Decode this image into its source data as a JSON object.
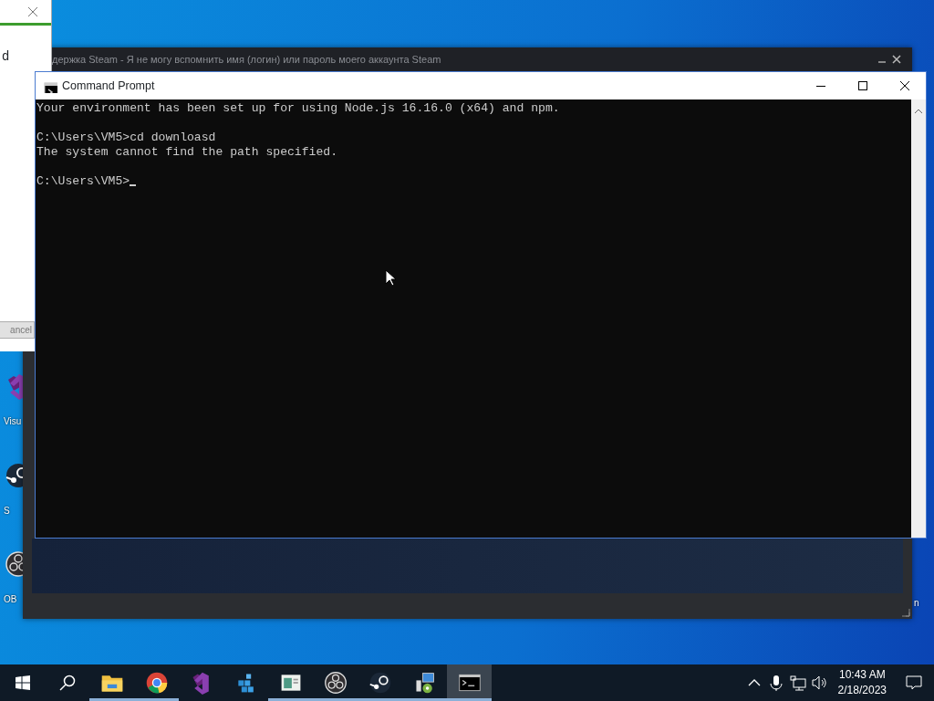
{
  "desktop_icons": [
    {
      "kind": "vs",
      "label": "Visu"
    },
    {
      "kind": "steam",
      "label": "S"
    },
    {
      "kind": "obs",
      "label": "OB"
    }
  ],
  "desktop_edge_text": "n",
  "steam_window": {
    "title": "держка Steam - Я не могу вспомнить имя (логин) или пароль моего аккаунта Steam"
  },
  "dialog": {
    "text": "d",
    "button": "ancel"
  },
  "command_prompt": {
    "title": "Command Prompt",
    "blocks": [
      [
        "Your environment has been set up for using Node.js 16.16.0 (x64) and npm."
      ],
      [
        "C:\\Users\\VM5>cd downloasd",
        "The system cannot find the path specified."
      ],
      [
        "C:\\Users\\VM5>"
      ]
    ]
  },
  "taskbar": {
    "apps": [
      {
        "kind": "explorer",
        "running": true,
        "selected": false
      },
      {
        "kind": "chrome",
        "running": true,
        "selected": false
      },
      {
        "kind": "vs",
        "running": false,
        "selected": false
      },
      {
        "kind": "cubes",
        "running": false,
        "selected": false
      },
      {
        "kind": "notepad",
        "running": true,
        "selected": false
      },
      {
        "kind": "obs",
        "running": true,
        "selected": false
      },
      {
        "kind": "steam",
        "running": true,
        "selected": false
      },
      {
        "kind": "installer",
        "running": true,
        "selected": false
      },
      {
        "kind": "cmd",
        "running": true,
        "selected": true
      }
    ],
    "time": "10:43 AM",
    "date": "2/18/2023"
  }
}
